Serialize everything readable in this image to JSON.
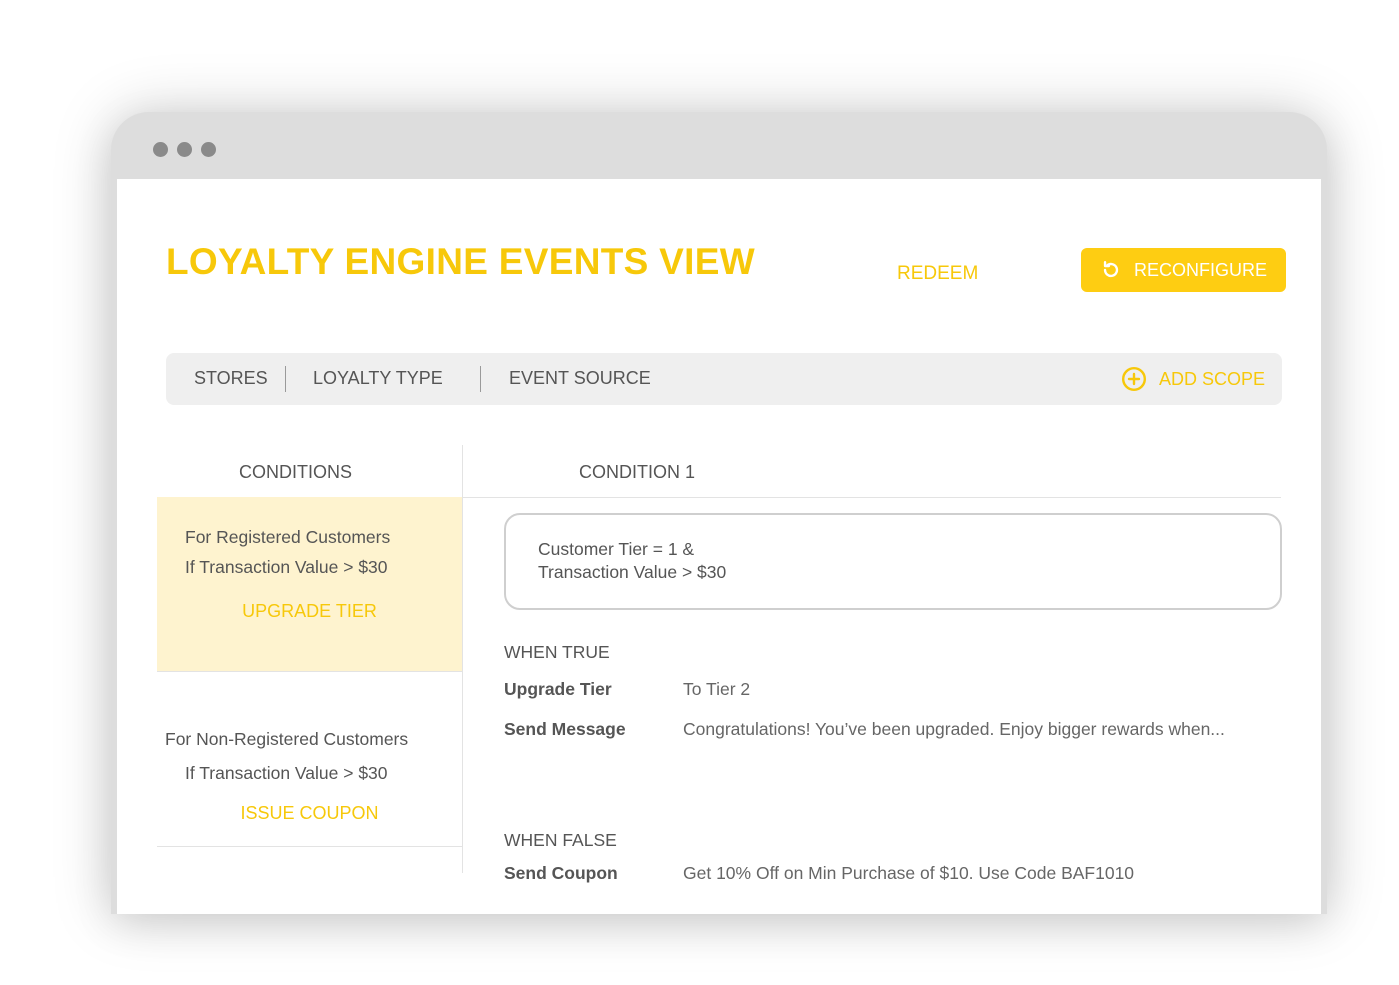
{
  "window": {
    "controls": [
      "dot",
      "dot",
      "dot"
    ]
  },
  "header": {
    "title": "LOYALTY ENGINE EVENTS VIEW",
    "redeem_label": "REDEEM",
    "reconfigure_label": "RECONFIGURE",
    "reconfigure_icon": "refresh-icon"
  },
  "scope_bar": {
    "items": [
      {
        "label": "STORES"
      },
      {
        "label": "LOYALTY TYPE"
      },
      {
        "label": "EVENT SOURCE"
      }
    ],
    "add_scope_label": "ADD SCOPE",
    "add_scope_icon": "plus-circle-icon"
  },
  "conditions_panel": {
    "header": "CONDITIONS",
    "items": [
      {
        "line1": "For Registered Customers",
        "line2": "If Transaction Value > $30",
        "action": "UPGRADE TIER",
        "active": true
      },
      {
        "line1": "For Non-Registered Customers",
        "line2": "If Transaction Value > $30",
        "action": "ISSUE COUPON",
        "active": false
      }
    ]
  },
  "detail_panel": {
    "header": "CONDITION 1",
    "condition_lines": [
      "Customer Tier = 1 &",
      "Transaction Value > $30"
    ],
    "when_true": {
      "label": "WHEN TRUE",
      "rows": [
        {
          "label": "Upgrade Tier",
          "value": "To Tier 2"
        },
        {
          "label": "Send Message",
          "value": "Congratulations! You’ve been upgraded. Enjoy bigger rewards when..."
        }
      ]
    },
    "when_false": {
      "label": "WHEN FALSE",
      "rows": [
        {
          "label": "Send Coupon",
          "value": "Get 10% Off on Min Purchase of $10. Use Code BAF1010"
        }
      ]
    }
  },
  "colors": {
    "accent": "#f7c80a",
    "button_bg": "#fecd12",
    "active_card_bg": "#fef3cf",
    "text": "#555555"
  }
}
